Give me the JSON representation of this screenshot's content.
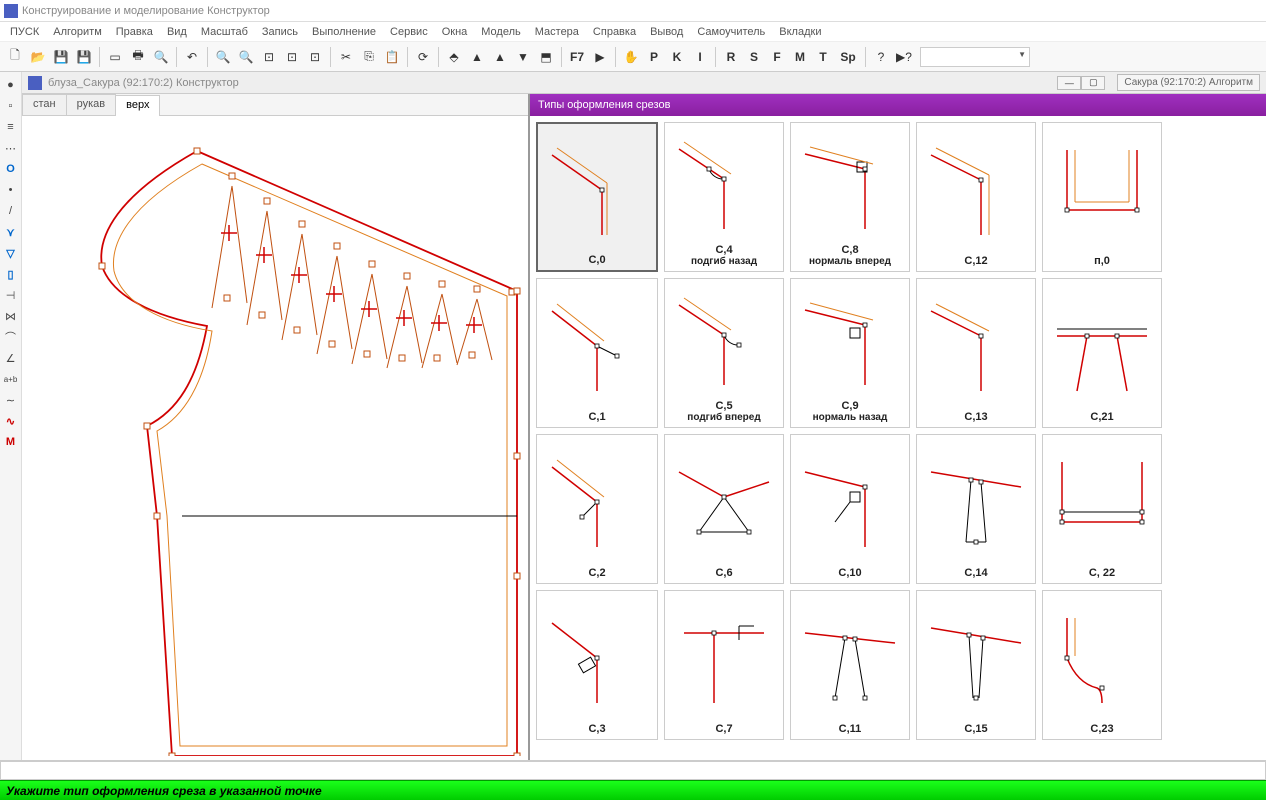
{
  "app": {
    "title": "Конструирование и моделирование  Конструктор"
  },
  "menu": [
    "ПУСК",
    "Алгоритм",
    "Правка",
    "Вид",
    "Масштаб",
    "Запись",
    "Выполнение",
    "Сервис",
    "Окна",
    "Модель",
    "Мастера",
    "Справка",
    "Вывод",
    "Самоучитель",
    "Вкладки"
  ],
  "toolbar": {
    "labels": {
      "f7": "F7",
      "p": "P",
      "k": "K",
      "i": "I",
      "r": "R",
      "s": "S",
      "f": "F",
      "m": "M",
      "t": "T",
      "sp": "Sp"
    }
  },
  "vtoolbar": [
    {
      "name": "dot-icon",
      "glyph": "●",
      "cls": ""
    },
    {
      "name": "square-icon",
      "glyph": "▫",
      "cls": ""
    },
    {
      "name": "lines-icon",
      "glyph": "≡",
      "cls": ""
    },
    {
      "name": "dotted-icon",
      "glyph": "⋯",
      "cls": ""
    },
    {
      "name": "o-icon",
      "glyph": "O",
      "cls": "blue"
    },
    {
      "name": "dot2-icon",
      "glyph": "•",
      "cls": ""
    },
    {
      "name": "slash-icon",
      "glyph": "/",
      "cls": ""
    },
    {
      "name": "angle-icon",
      "glyph": "⋎",
      "cls": "blue"
    },
    {
      "name": "bucket-icon",
      "glyph": "▽",
      "cls": "blue"
    },
    {
      "name": "rect-icon",
      "glyph": "▯",
      "cls": "blue"
    },
    {
      "name": "bracket-icon",
      "glyph": "⊣",
      "cls": ""
    },
    {
      "name": "zigzag-icon",
      "glyph": "⋈",
      "cls": ""
    },
    {
      "name": "arc-icon",
      "glyph": "⌒",
      "cls": ""
    },
    {
      "name": "angle2-icon",
      "glyph": "∠",
      "cls": ""
    },
    {
      "name": "ab-icon",
      "glyph": "a+b",
      "cls": ""
    },
    {
      "name": "wave-icon",
      "glyph": "∼",
      "cls": ""
    },
    {
      "name": "redwave-icon",
      "glyph": "∿",
      "cls": "red"
    },
    {
      "name": "m-icon",
      "glyph": "M",
      "cls": "red"
    }
  ],
  "document": {
    "title": "блуза_Сакура (92:170:2) Конструктор",
    "extra_tab": "Сакура (92:170:2) Алгоритм",
    "tabs": [
      "стан",
      "рукав",
      "верх"
    ],
    "active_tab": 2
  },
  "right_panel": {
    "title": "Типы оформления срезов"
  },
  "cells": [
    {
      "id": "c0",
      "label": "С,0",
      "sub": "",
      "selected": true
    },
    {
      "id": "c4",
      "label": "С,4",
      "sub": "подгиб назад"
    },
    {
      "id": "c8",
      "label": "С,8",
      "sub": "нормаль вперед"
    },
    {
      "id": "c12",
      "label": "С,12",
      "sub": ""
    },
    {
      "id": "p0",
      "label": "п,0",
      "sub": ""
    },
    {
      "id": "blank1",
      "label": "",
      "sub": ""
    },
    {
      "id": "c1",
      "label": "С,1",
      "sub": ""
    },
    {
      "id": "c5",
      "label": "С,5",
      "sub": "подгиб вперед"
    },
    {
      "id": "c9",
      "label": "С,9",
      "sub": "нормаль назад"
    },
    {
      "id": "c13",
      "label": "С,13",
      "sub": ""
    },
    {
      "id": "c21",
      "label": "С,21",
      "sub": ""
    },
    {
      "id": "blank2",
      "label": "",
      "sub": ""
    },
    {
      "id": "c2",
      "label": "С,2",
      "sub": ""
    },
    {
      "id": "c6",
      "label": "С,6",
      "sub": ""
    },
    {
      "id": "c10",
      "label": "С,10",
      "sub": ""
    },
    {
      "id": "c14",
      "label": "С,14",
      "sub": ""
    },
    {
      "id": "c22",
      "label": "С, 22",
      "sub": ""
    },
    {
      "id": "blank3",
      "label": "",
      "sub": ""
    },
    {
      "id": "c3",
      "label": "С,3",
      "sub": ""
    },
    {
      "id": "c7",
      "label": "С,7",
      "sub": ""
    },
    {
      "id": "c11",
      "label": "С,11",
      "sub": ""
    },
    {
      "id": "c15",
      "label": "С,15",
      "sub": ""
    },
    {
      "id": "c23",
      "label": "С,23",
      "sub": ""
    },
    {
      "id": "blank4",
      "label": "",
      "sub": ""
    }
  ],
  "status": "Укажите тип оформления среза в указанной точке"
}
